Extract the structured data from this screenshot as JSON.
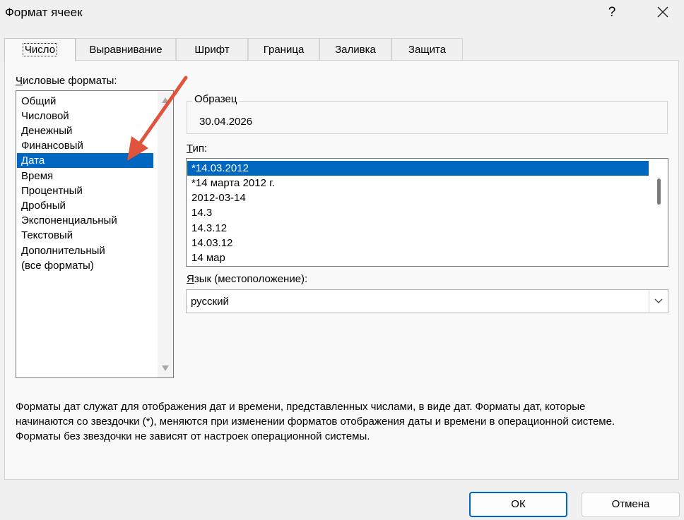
{
  "window": {
    "title": "Формат ячеек",
    "help": "?"
  },
  "tabs": [
    "Число",
    "Выравнивание",
    "Шрифт",
    "Граница",
    "Заливка",
    "Защита"
  ],
  "category": {
    "label": "Числовые форматы:",
    "items": [
      "Общий",
      "Числовой",
      "Денежный",
      "Финансовый",
      "Дата",
      "Время",
      "Процентный",
      "Дробный",
      "Экспоненциальный",
      "Текстовый",
      "Дополнительный",
      "(все форматы)"
    ],
    "selected": "Дата"
  },
  "sample": {
    "label": "Образец",
    "value": "30.04.2026"
  },
  "type": {
    "label": "Тип:",
    "items": [
      "*14.03.2012",
      "*14 марта 2012 г.",
      "2012-03-14",
      "14.3",
      "14.3.12",
      "14.03.12",
      "14 мар"
    ],
    "selected": "*14.03.2012"
  },
  "locale": {
    "label": "Язык (местоположение):",
    "value": "русский"
  },
  "description": [
    "Форматы дат служат для отображения дат и времени, представленных числами, в виде дат. Форматы дат, которые",
    "начинаются со звездочки (*), меняются при изменении форматов отображения даты и времени в операционной системе.",
    "Форматы без звездочки не зависят от настроек операционной системы."
  ],
  "buttons": {
    "ok": "ОК",
    "cancel": "Отмена"
  },
  "colors": {
    "selection": "#0067c0",
    "annotation_arrow": "#e0533d"
  }
}
